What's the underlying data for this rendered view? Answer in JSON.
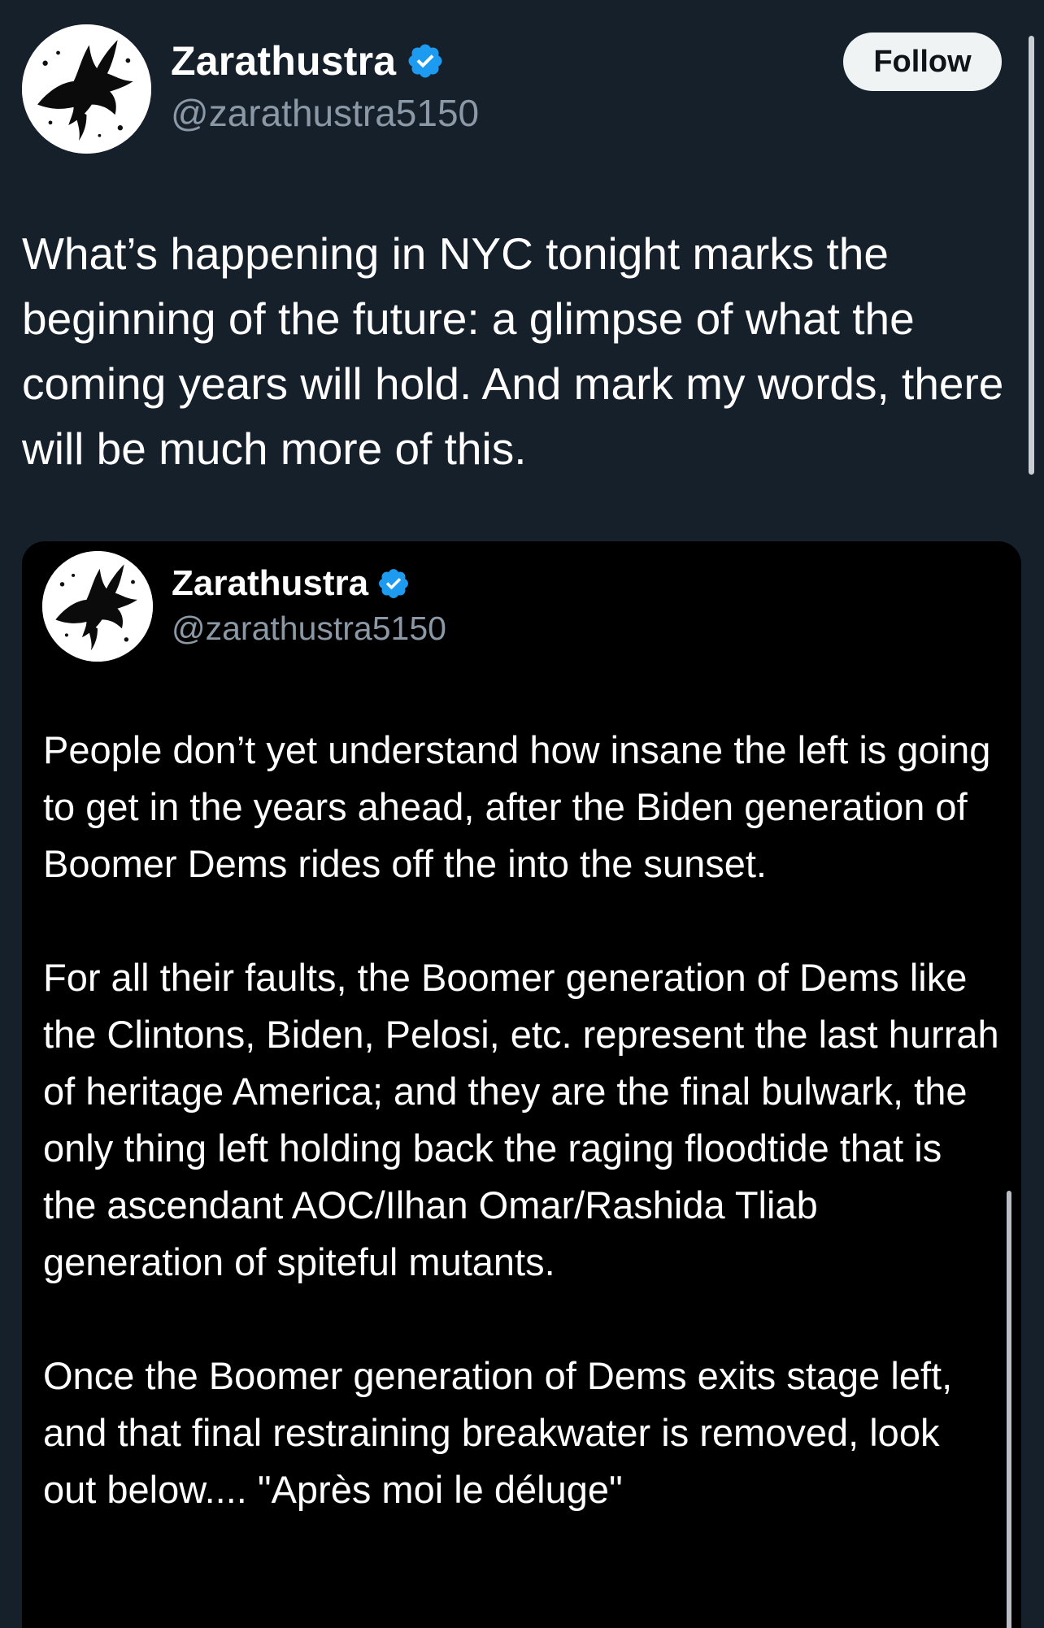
{
  "author": {
    "display_name": "Zarathustra",
    "handle": "@zarathustra5150",
    "verified": true
  },
  "follow_label": "Follow",
  "tweet": {
    "text": "What’s happening in NYC tonight marks the beginning of the future: a glimpse of what the coming years will hold. And mark my words, there will be much more of this."
  },
  "quoted_tweet": {
    "display_name": "Zarathustra",
    "handle": "@zarathustra5150",
    "verified": true,
    "paragraphs": [
      "People don’t yet understand how insane the left is going to get in the years ahead, after the Biden generation of Boomer Dems rides off the into the sunset.",
      "For all their faults, the Boomer generation of Dems like the Clintons, Biden, Pelosi, etc. represent the last hurrah of heritage America; and they are the final bulwark, the only thing left holding back the raging floodtide that is the ascendant AOC/Ilhan Omar/Rashida Tliab generation of spiteful mutants.",
      "Once the Boomer generation of Dems exits stage left, and that final restraining breakwater is removed, look out below.... \"Après moi le déluge\""
    ]
  },
  "colors": {
    "background": "#16202b",
    "quote_background": "#000000",
    "verified_blue": "#1d9bf0",
    "secondary_text": "#8b98a5",
    "follow_bg": "#eff3f4"
  },
  "icons": {
    "avatar": "raven-avatar",
    "verified": "verified-badge-icon"
  }
}
